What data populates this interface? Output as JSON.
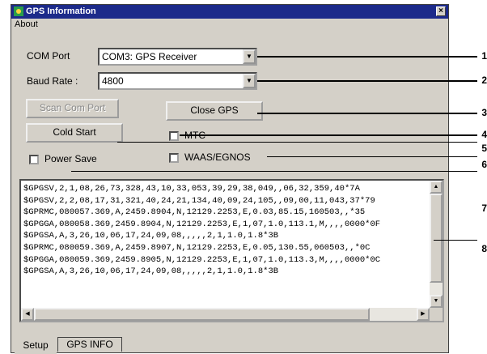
{
  "window": {
    "title": "GPS Information",
    "close_glyph": "×"
  },
  "menu": {
    "about": "About"
  },
  "com_port": {
    "label": "COM Port",
    "value": "COM3: GPS Receiver"
  },
  "baud_rate": {
    "label": "Baud Rate :",
    "value": "4800"
  },
  "buttons": {
    "scan": "Scan Com Port",
    "close_gps": "Close GPS",
    "cold_start": "Cold Start"
  },
  "checkboxes": {
    "mtc": {
      "label": "MTC",
      "checked": false
    },
    "waas": {
      "label": "WAAS/EGNOS",
      "checked": false
    },
    "power_save": {
      "label": "Power Save",
      "checked": false
    }
  },
  "log": {
    "lines": [
      "$GPGSV,2,1,08,26,73,328,43,10,33,053,39,29,38,049,,06,32,359,40*7A",
      "$GPGSV,2,2,08,17,31,321,40,24,21,134,40,09,24,105,,09,00,11,043,37*79",
      "$GPRMC,080057.369,A,2459.8904,N,12129.2253,E,0.03,85.15,160503,,*35",
      "$GPGGA,080058.369,2459.8904,N,12129.2253,E,1,07,1.0,113.1,M,,,,0000*0F",
      "$GPGSA,A,3,26,10,06,17,24,09,08,,,,,2,1,1.0,1.8*3B",
      "$GPRMC,080059.369,A,2459.8907,N,12129.2253,E,0.05,130.55,060503,,*0C",
      "$GPGGA,080059.369,2459.8905,N,12129.2253,E,1,07,1.0,113.3,M,,,,0000*0C",
      "$GPGSA,A,3,26,10,06,17,24,09,08,,,,,2,1,1.0,1.8*3B"
    ]
  },
  "tabs": {
    "setup": "Setup",
    "gps_info": "GPS INFO"
  },
  "callouts": [
    "1",
    "2",
    "3",
    "4",
    "5",
    "6",
    "7",
    "8"
  ]
}
